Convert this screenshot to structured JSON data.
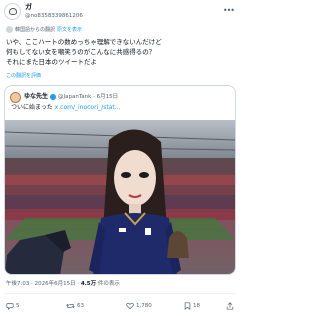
{
  "author": {
    "display_name": "ガ",
    "handle": "@no8358339861206"
  },
  "translate": {
    "label": "韓国語からの翻訳",
    "link": "原文を表示"
  },
  "tweet": {
    "lines": [
      "いや、ここハートの数めっちゃ理解できないんだけど",
      "何もしてない女を嘲笑うのがこんなに共感得るの？",
      "それにまた日本のツイートだよ"
    ]
  },
  "rate_link": "この翻訳を評価",
  "quote": {
    "display_name": "ゆな先生",
    "handle": "@JapanTank",
    "date": "6月15日",
    "text": "ついに始まった",
    "link": "x.com/_inocori_/stat..."
  },
  "timestamp": {
    "time": "午後7:03 · 2026年6月15日 · ",
    "views": "4.5万",
    "views_label": " 件の表示"
  },
  "actions": {
    "reply": "5",
    "retweet": "63",
    "like": "1,780",
    "bookmark": "18"
  },
  "colors": {
    "accent": "#1d9bf0",
    "secondary_text": "#536471",
    "border": "#cfd9de",
    "jersey": "#1f2a6b"
  }
}
